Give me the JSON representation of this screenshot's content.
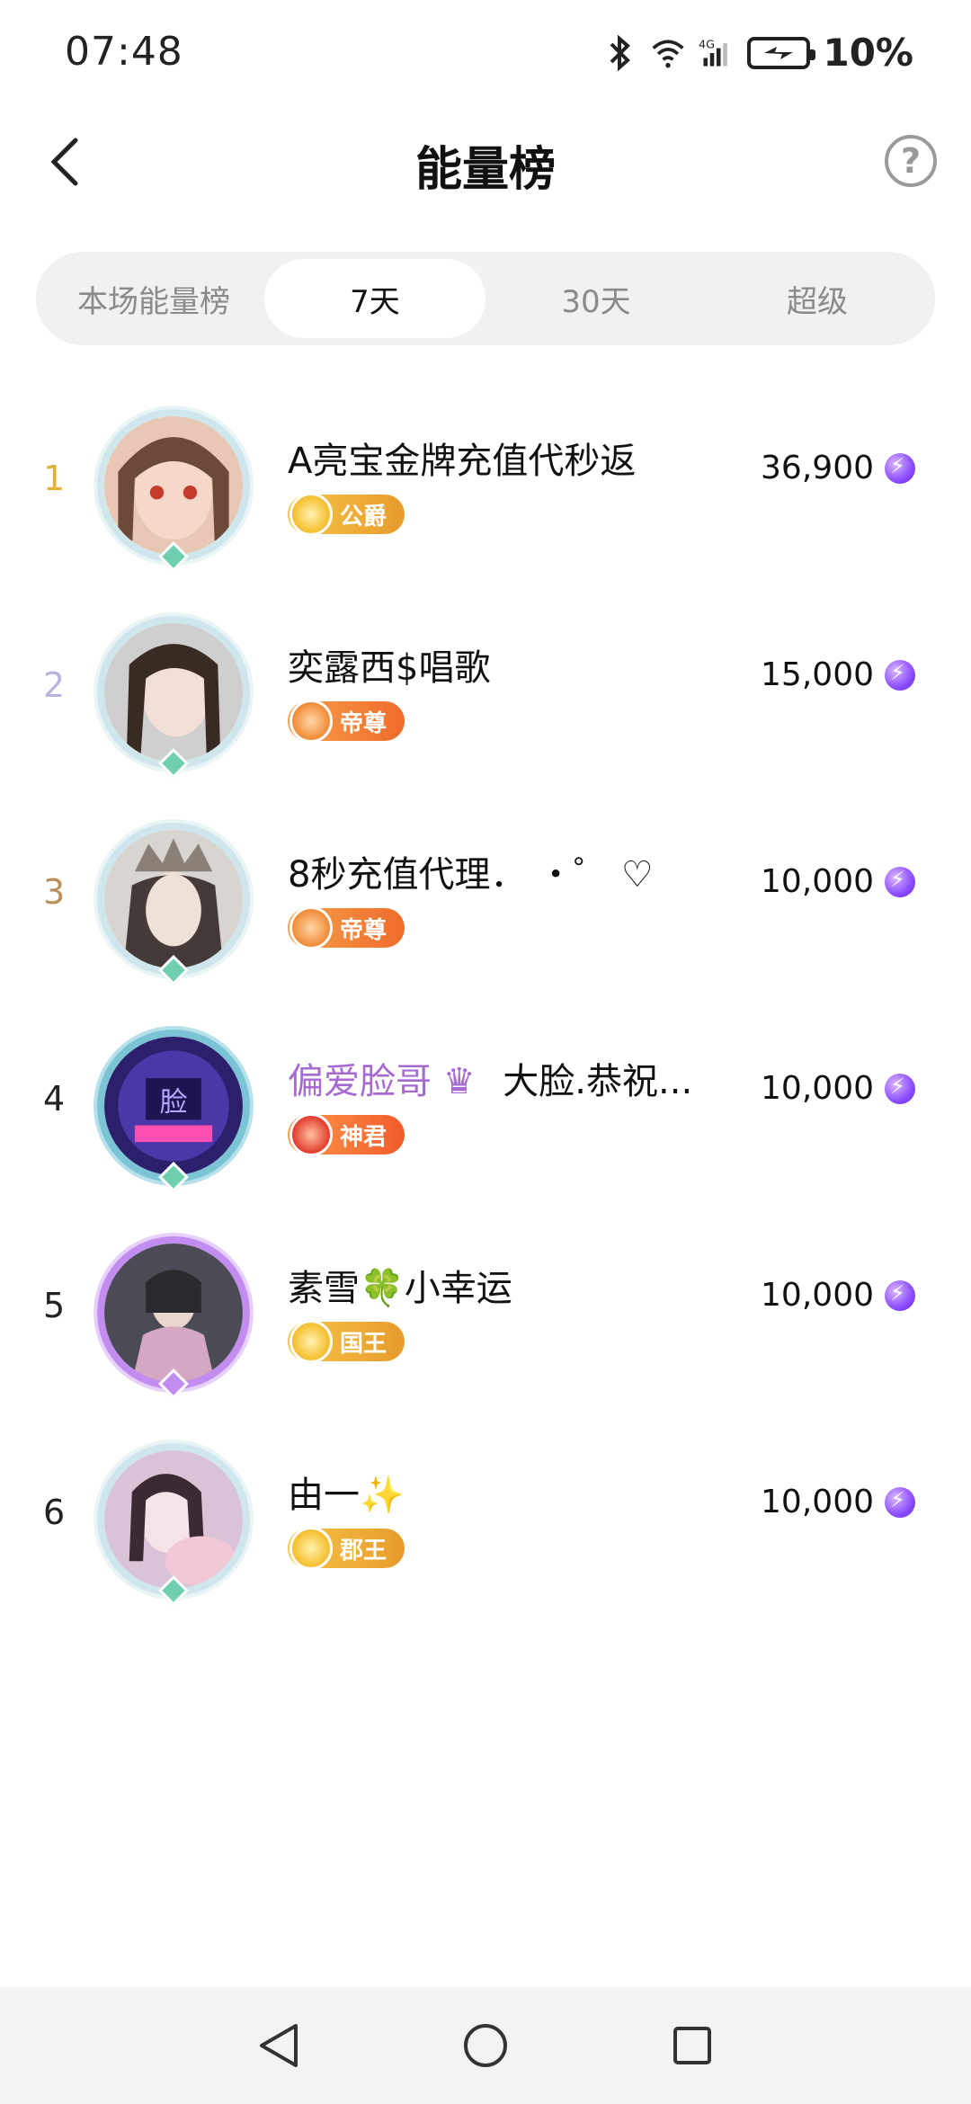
{
  "status": {
    "time": "07:48",
    "battery": "10%"
  },
  "header": {
    "title": "能量榜",
    "help_symbol": "?"
  },
  "tabs": [
    {
      "label": "本场能量榜",
      "active": false
    },
    {
      "label": "7天",
      "active": true
    },
    {
      "label": "30天",
      "active": false
    },
    {
      "label": "超级",
      "active": false
    }
  ],
  "leaderboard": [
    {
      "rank": "1",
      "name": "A亮宝金牌充值代秒返",
      "badge": "公爵",
      "score": "36,900"
    },
    {
      "rank": "2",
      "name": "奕露西$唱歌",
      "badge": "帝尊",
      "score": "15,000"
    },
    {
      "rank": "3",
      "name": "8秒充值代理．  ・゜ ♡",
      "badge": "帝尊",
      "score": "10,000"
    },
    {
      "rank": "4",
      "name_prefix": "偏爱脸哥",
      "name": "大脸.恭祝...",
      "badge": "神君",
      "score": "10,000"
    },
    {
      "rank": "5",
      "name": "素雪🍀小幸运",
      "badge": "国王",
      "score": "10,000"
    },
    {
      "rank": "6",
      "name": "由一✨",
      "badge": "郡王",
      "score": "10,000"
    }
  ],
  "colors": {
    "rank1": "#e0b236",
    "rank2": "#b9b3e0",
    "rank3": "#b98f5b",
    "energy": "#8b4dff",
    "purple_name": "#a66ad1"
  }
}
